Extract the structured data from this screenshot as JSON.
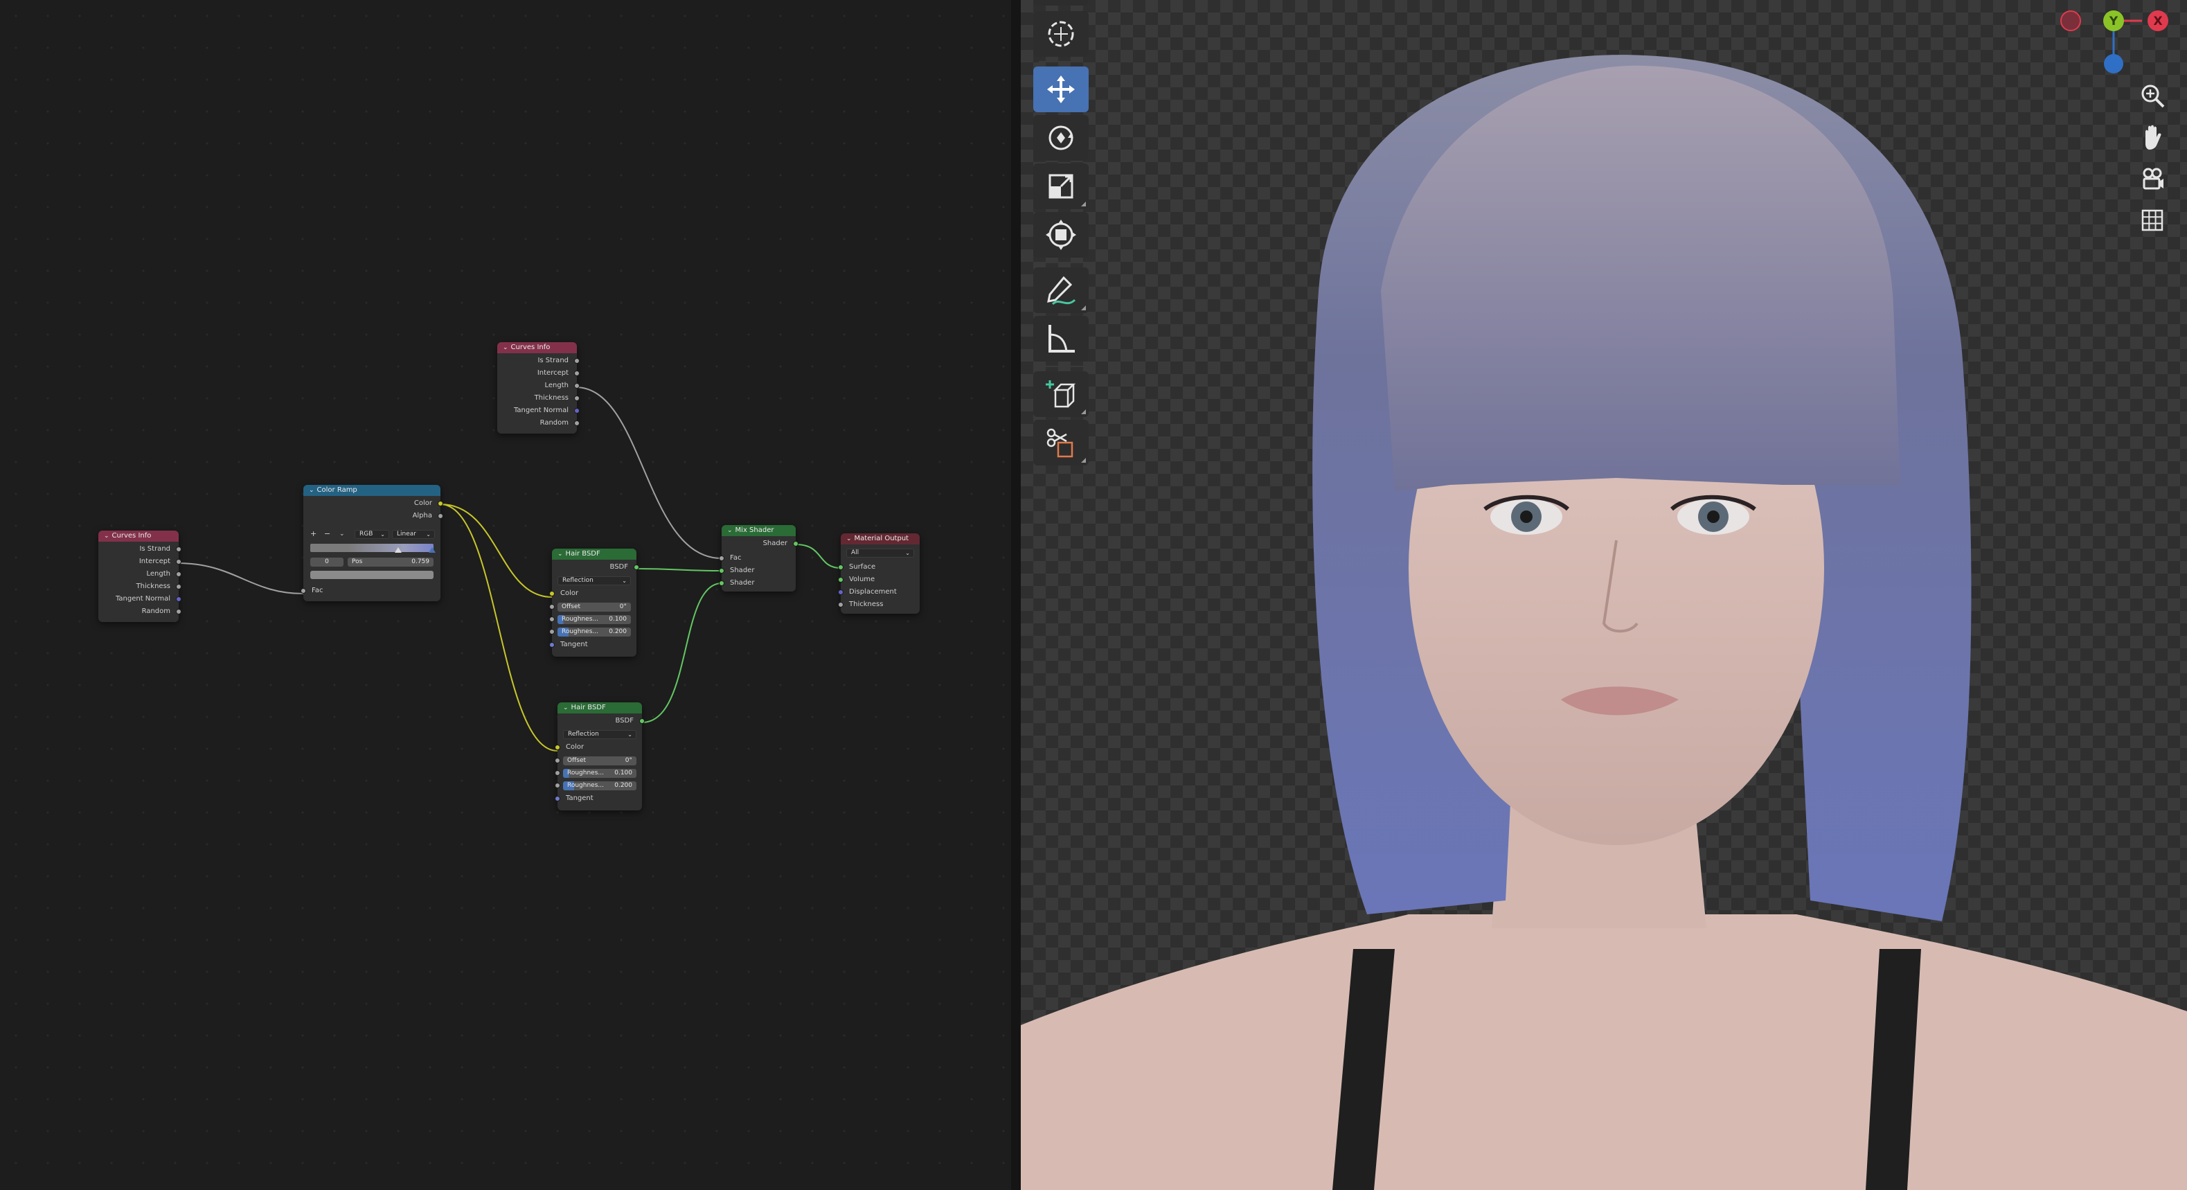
{
  "node_editor": {
    "nodes": {
      "curves_info_top": {
        "title": "Curves Info",
        "outputs": [
          "Is Strand",
          "Intercept",
          "Length",
          "Thickness",
          "Tangent Normal",
          "Random"
        ]
      },
      "curves_info_left": {
        "title": "Curves Info",
        "outputs": [
          "Is Strand",
          "Intercept",
          "Length",
          "Thickness",
          "Tangent Normal",
          "Random"
        ]
      },
      "color_ramp": {
        "title": "Color Ramp",
        "outputs": [
          "Color",
          "Alpha"
        ],
        "add_symbol": "+",
        "remove_symbol": "−",
        "color_mode": "RGB",
        "interpolation": "Linear",
        "stop_index": "0",
        "pos_label": "Pos",
        "pos_value": "0.759",
        "input": "Fac"
      },
      "hair_bsdf_1": {
        "title": "Hair BSDF",
        "output": "BSDF",
        "mode": "Reflection",
        "color_label": "Color",
        "offset_label": "Offset",
        "offset_value": "0°",
        "roughness1_label": "Roughnes...",
        "roughness1_value": "0.100",
        "roughness2_label": "Roughnes...",
        "roughness2_value": "0.200",
        "tangent_label": "Tangent"
      },
      "hair_bsdf_2": {
        "title": "Hair BSDF",
        "output": "BSDF",
        "mode": "Reflection",
        "color_label": "Color",
        "offset_label": "Offset",
        "offset_value": "0°",
        "roughness1_label": "Roughnes...",
        "roughness1_value": "0.100",
        "roughness2_label": "Roughnes...",
        "roughness2_value": "0.200",
        "tangent_label": "Tangent"
      },
      "mix_shader": {
        "title": "Mix Shader",
        "output": "Shader",
        "inputs": [
          "Fac",
          "Shader",
          "Shader"
        ]
      },
      "material_output": {
        "title": "Material Output",
        "target": "All",
        "inputs": [
          "Surface",
          "Volume",
          "Displacement",
          "Thickness"
        ]
      }
    }
  },
  "viewport": {
    "gizmo": {
      "x_label": "X",
      "y_label": "Y"
    },
    "tools": [
      "cursor-tool",
      "move-tool",
      "rotate-tool",
      "scale-tool",
      "transform-tool",
      "annotate-tool",
      "measure-tool",
      "add-cube-tool",
      "cut-tool"
    ],
    "nav": [
      "zoom-icon",
      "pan-hand-icon",
      "camera-icon",
      "grid-icon"
    ]
  },
  "colors": {
    "accent_active": "#4772b3",
    "socket_gray": "#a1a1a1",
    "socket_yellow": "#c7c729",
    "socket_green": "#63c763",
    "gizmo_x": "#e03a4e",
    "gizmo_y": "#8bc427",
    "gizmo_z": "#2f6fc5",
    "hair": "#6a74a8"
  }
}
